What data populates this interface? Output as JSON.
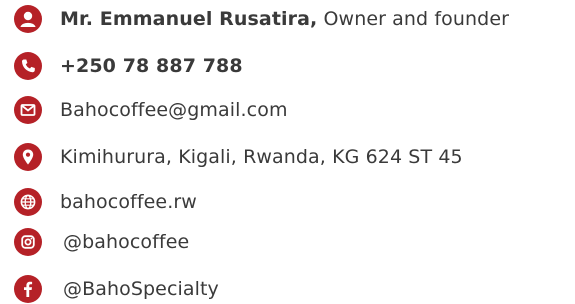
{
  "accent_color": "#b52127",
  "contacts": {
    "owner": {
      "icon": "person-icon",
      "name": "Mr. Emmanuel Rusatira,",
      "role": "Owner and founder"
    },
    "phone": {
      "icon": "phone-icon",
      "value": "+250 78 887 788"
    },
    "email": {
      "icon": "envelope-icon",
      "value": "Bahocoffee@gmail.com"
    },
    "address": {
      "icon": "map-pin-icon",
      "value": "Kimihurura, Kigali, Rwanda, KG 624 ST 45"
    },
    "website": {
      "icon": "globe-icon",
      "value": "bahocoffee.rw"
    },
    "instagram": {
      "icon": "instagram-icon",
      "value": "@bahocoffee"
    },
    "facebook": {
      "icon": "facebook-icon",
      "value": "@BahoSpecialty"
    }
  }
}
